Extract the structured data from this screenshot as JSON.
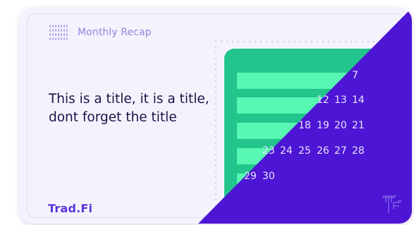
{
  "header": {
    "label": "Monthly Recap",
    "icon": "calendar-grid-icon"
  },
  "title": "This is a title, it is a  title,\ndont forget the title",
  "brand": {
    "text": "Trad.F",
    "accent": "i"
  },
  "calendar": {
    "rows": [
      [
        "7"
      ],
      [
        "12",
        "13",
        "14"
      ],
      [
        "18",
        "19",
        "20",
        "21"
      ],
      [
        "23",
        "24",
        "25",
        "26",
        "27",
        "28"
      ],
      [
        "29",
        "30"
      ]
    ]
  },
  "colors": {
    "card_bg": "#f4f3fd",
    "overlay": "#4d15d4",
    "calendar_green": "#22c58b",
    "calendar_bar": "#58f7b3",
    "title_text": "#1a154a",
    "brand": "#5b34d6"
  },
  "logo": {
    "icon": "tf-logo-icon"
  }
}
